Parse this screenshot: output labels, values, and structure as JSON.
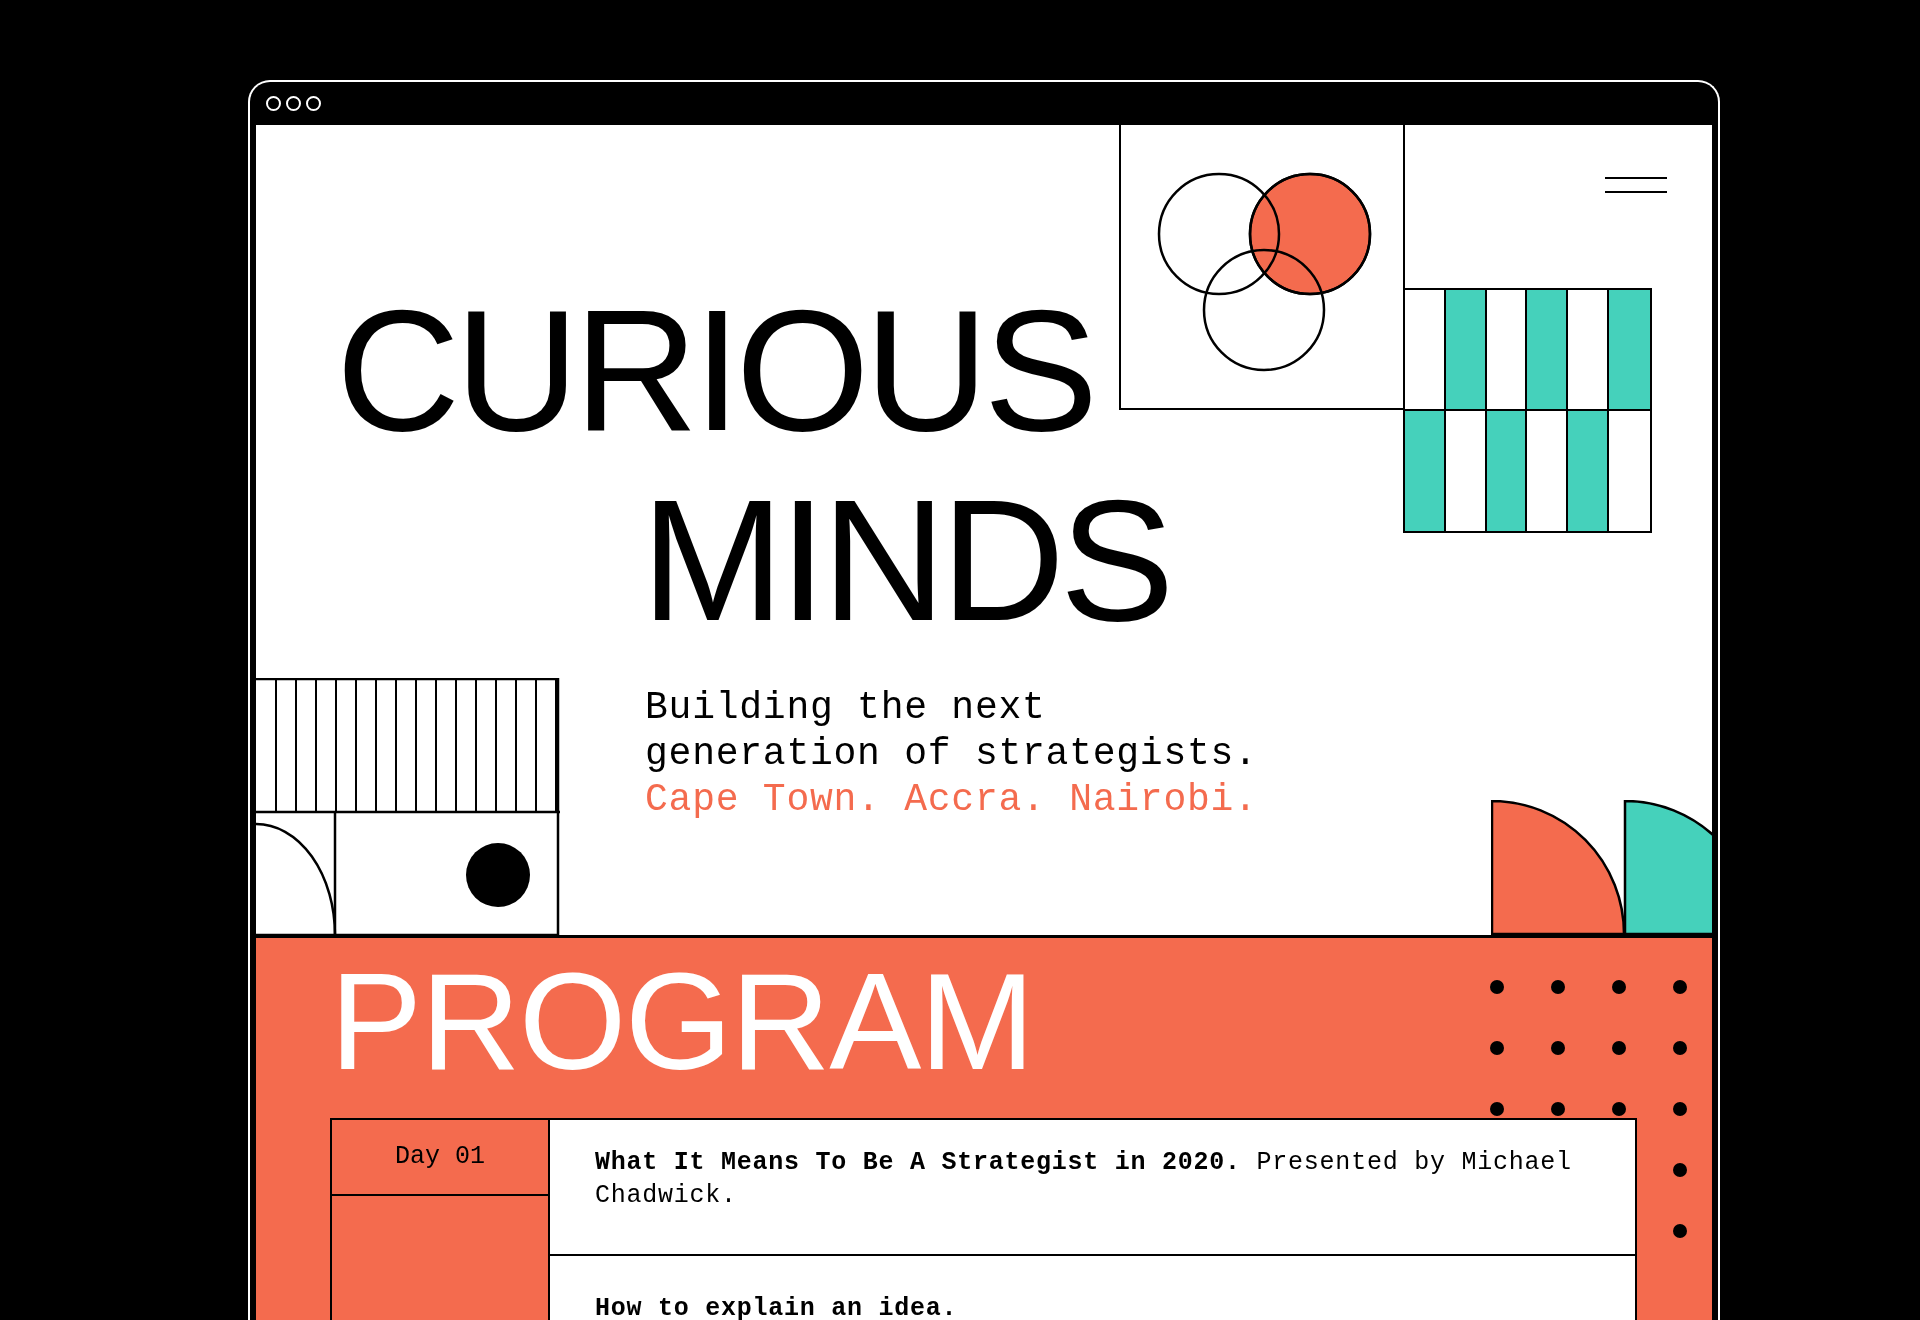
{
  "hero": {
    "title_lines": [
      "CURIOUS",
      "MINDS"
    ],
    "tagline_lines": [
      "Building the next",
      "generation of strategists."
    ],
    "locations": "Cape Town. Accra. Nairobi."
  },
  "program": {
    "title": "PROGRAM",
    "days": [
      {
        "label": "Day 01"
      }
    ],
    "sessions": [
      {
        "text": "**What It Means To Be A Strategist in 2020.** Presented by Michael Chadwick."
      },
      {
        "text": "**How to explain an idea.**"
      }
    ]
  }
}
